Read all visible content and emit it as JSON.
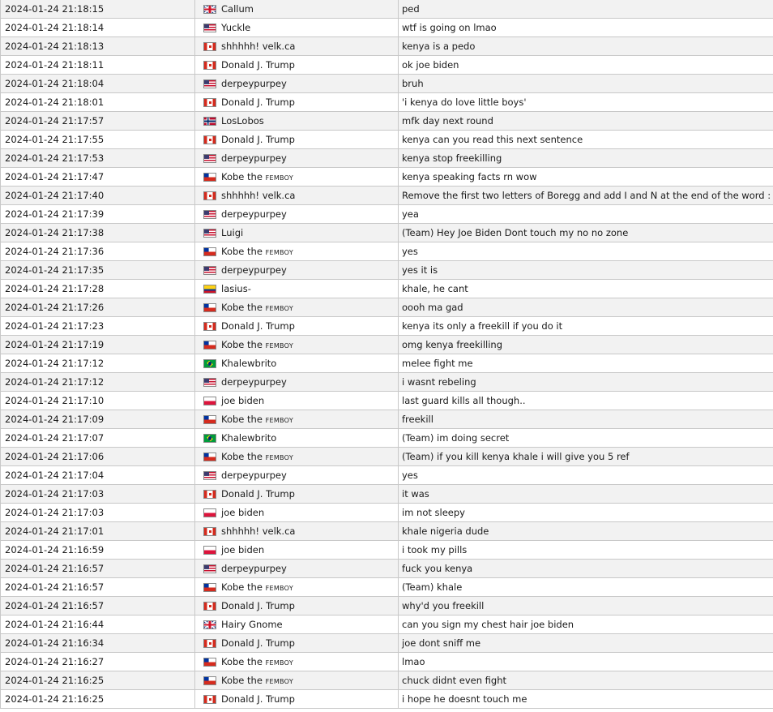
{
  "chat_log": {
    "rows": [
      {
        "time": "2024-01-24 21:18:15",
        "flag": "gb-flag-icon",
        "name": "Callum",
        "name_sc": "",
        "message": "ped"
      },
      {
        "time": "2024-01-24 21:18:14",
        "flag": "us-flag-icon",
        "name": "Yuckle",
        "name_sc": "",
        "message": "wtf is going on lmao"
      },
      {
        "time": "2024-01-24 21:18:13",
        "flag": "ca-flag-icon",
        "name": "shhhhh! velk.ca",
        "name_sc": "",
        "message": "kenya is a pedo"
      },
      {
        "time": "2024-01-24 21:18:11",
        "flag": "ca-flag-icon",
        "name": "Donald J. Trump",
        "name_sc": "",
        "message": "ok joe biden"
      },
      {
        "time": "2024-01-24 21:18:04",
        "flag": "us-flag-icon",
        "name": "derpeypurpey",
        "name_sc": "",
        "message": "bruh"
      },
      {
        "time": "2024-01-24 21:18:01",
        "flag": "ca-flag-icon",
        "name": "Donald J. Trump",
        "name_sc": "",
        "message": "'i kenya do love little boys'"
      },
      {
        "time": "2024-01-24 21:17:57",
        "flag": "no-flag-icon",
        "name": "LosLobos",
        "name_sc": "",
        "message": "mfk day next round"
      },
      {
        "time": "2024-01-24 21:17:55",
        "flag": "ca-flag-icon",
        "name": "Donald J. Trump",
        "name_sc": "",
        "message": "kenya can you read this next sentence"
      },
      {
        "time": "2024-01-24 21:17:53",
        "flag": "us-flag-icon",
        "name": "derpeypurpey",
        "name_sc": "",
        "message": "kenya stop freekilling"
      },
      {
        "time": "2024-01-24 21:17:47",
        "flag": "cl-flag-icon",
        "name": "Kobe the ",
        "name_sc": "FEMBOY",
        "message": "kenya speaking facts rn wow"
      },
      {
        "time": "2024-01-24 21:17:40",
        "flag": "ca-flag-icon",
        "name": "shhhhh! velk.ca",
        "name_sc": "",
        "message": "Remove the first two letters of Boregg and add I and N at the end of the word : )"
      },
      {
        "time": "2024-01-24 21:17:39",
        "flag": "us-flag-icon",
        "name": "derpeypurpey",
        "name_sc": "",
        "message": "yea"
      },
      {
        "time": "2024-01-24 21:17:38",
        "flag": "us-flag-icon",
        "name": "Luigi",
        "name_sc": "",
        "message": "(Team) Hey Joe Biden Dont touch my no no zone"
      },
      {
        "time": "2024-01-24 21:17:36",
        "flag": "cl-flag-icon",
        "name": "Kobe the ",
        "name_sc": "FEMBOY",
        "message": "yes"
      },
      {
        "time": "2024-01-24 21:17:35",
        "flag": "us-flag-icon",
        "name": "derpeypurpey",
        "name_sc": "",
        "message": "yes it is"
      },
      {
        "time": "2024-01-24 21:17:28",
        "flag": "co-flag-icon",
        "name": "lasius-",
        "name_sc": "",
        "message": "khale, he cant"
      },
      {
        "time": "2024-01-24 21:17:26",
        "flag": "cl-flag-icon",
        "name": "Kobe the ",
        "name_sc": "FEMBOY",
        "message": "oooh ma gad"
      },
      {
        "time": "2024-01-24 21:17:23",
        "flag": "ca-flag-icon",
        "name": "Donald J. Trump",
        "name_sc": "",
        "message": "kenya its only a freekill if you do it"
      },
      {
        "time": "2024-01-24 21:17:19",
        "flag": "cl-flag-icon",
        "name": "Kobe the ",
        "name_sc": "FEMBOY",
        "message": "omg kenya freekilling"
      },
      {
        "time": "2024-01-24 21:17:12",
        "flag": "br-flag-icon",
        "name": "Khalewbrito",
        "name_sc": "",
        "message": "melee fight me"
      },
      {
        "time": "2024-01-24 21:17:12",
        "flag": "us-flag-icon",
        "name": "derpeypurpey",
        "name_sc": "",
        "message": "i wasnt rebeling"
      },
      {
        "time": "2024-01-24 21:17:10",
        "flag": "pl-flag-icon",
        "name": "joe biden",
        "name_sc": "",
        "message": "last guard kills all though.."
      },
      {
        "time": "2024-01-24 21:17:09",
        "flag": "cl-flag-icon",
        "name": "Kobe the ",
        "name_sc": "FEMBOY",
        "message": "freekill"
      },
      {
        "time": "2024-01-24 21:17:07",
        "flag": "br-flag-icon",
        "name": "Khalewbrito",
        "name_sc": "",
        "message": "(Team) im doing secret"
      },
      {
        "time": "2024-01-24 21:17:06",
        "flag": "cl-flag-icon",
        "name": "Kobe the ",
        "name_sc": "FEMBOY",
        "message": "(Team) if you kill kenya khale i will give you 5 ref"
      },
      {
        "time": "2024-01-24 21:17:04",
        "flag": "us-flag-icon",
        "name": "derpeypurpey",
        "name_sc": "",
        "message": "yes"
      },
      {
        "time": "2024-01-24 21:17:03",
        "flag": "ca-flag-icon",
        "name": "Donald J. Trump",
        "name_sc": "",
        "message": "it was"
      },
      {
        "time": "2024-01-24 21:17:03",
        "flag": "pl-flag-icon",
        "name": "joe biden",
        "name_sc": "",
        "message": "im not sleepy"
      },
      {
        "time": "2024-01-24 21:17:01",
        "flag": "ca-flag-icon",
        "name": "shhhhh! velk.ca",
        "name_sc": "",
        "message": "khale nigeria dude"
      },
      {
        "time": "2024-01-24 21:16:59",
        "flag": "pl-flag-icon",
        "name": "joe biden",
        "name_sc": "",
        "message": "i took my pills"
      },
      {
        "time": "2024-01-24 21:16:57",
        "flag": "us-flag-icon",
        "name": "derpeypurpey",
        "name_sc": "",
        "message": "fuck you kenya"
      },
      {
        "time": "2024-01-24 21:16:57",
        "flag": "cl-flag-icon",
        "name": "Kobe the ",
        "name_sc": "FEMBOY",
        "message": "(Team) khale"
      },
      {
        "time": "2024-01-24 21:16:57",
        "flag": "ca-flag-icon",
        "name": "Donald J. Trump",
        "name_sc": "",
        "message": "why'd you freekill"
      },
      {
        "time": "2024-01-24 21:16:44",
        "flag": "gb-flag-icon",
        "name": "Hairy Gnome",
        "name_sc": "",
        "message": "can you sign my chest hair joe biden"
      },
      {
        "time": "2024-01-24 21:16:34",
        "flag": "ca-flag-icon",
        "name": "Donald J. Trump",
        "name_sc": "",
        "message": "joe dont sniff me"
      },
      {
        "time": "2024-01-24 21:16:27",
        "flag": "cl-flag-icon",
        "name": "Kobe the ",
        "name_sc": "FEMBOY",
        "message": "lmao"
      },
      {
        "time": "2024-01-24 21:16:25",
        "flag": "cl-flag-icon",
        "name": "Kobe the ",
        "name_sc": "FEMBOY",
        "message": "chuck didnt even fight"
      },
      {
        "time": "2024-01-24 21:16:25",
        "flag": "ca-flag-icon",
        "name": "Donald J. Trump",
        "name_sc": "",
        "message": "i hope he doesnt touch me"
      }
    ]
  }
}
